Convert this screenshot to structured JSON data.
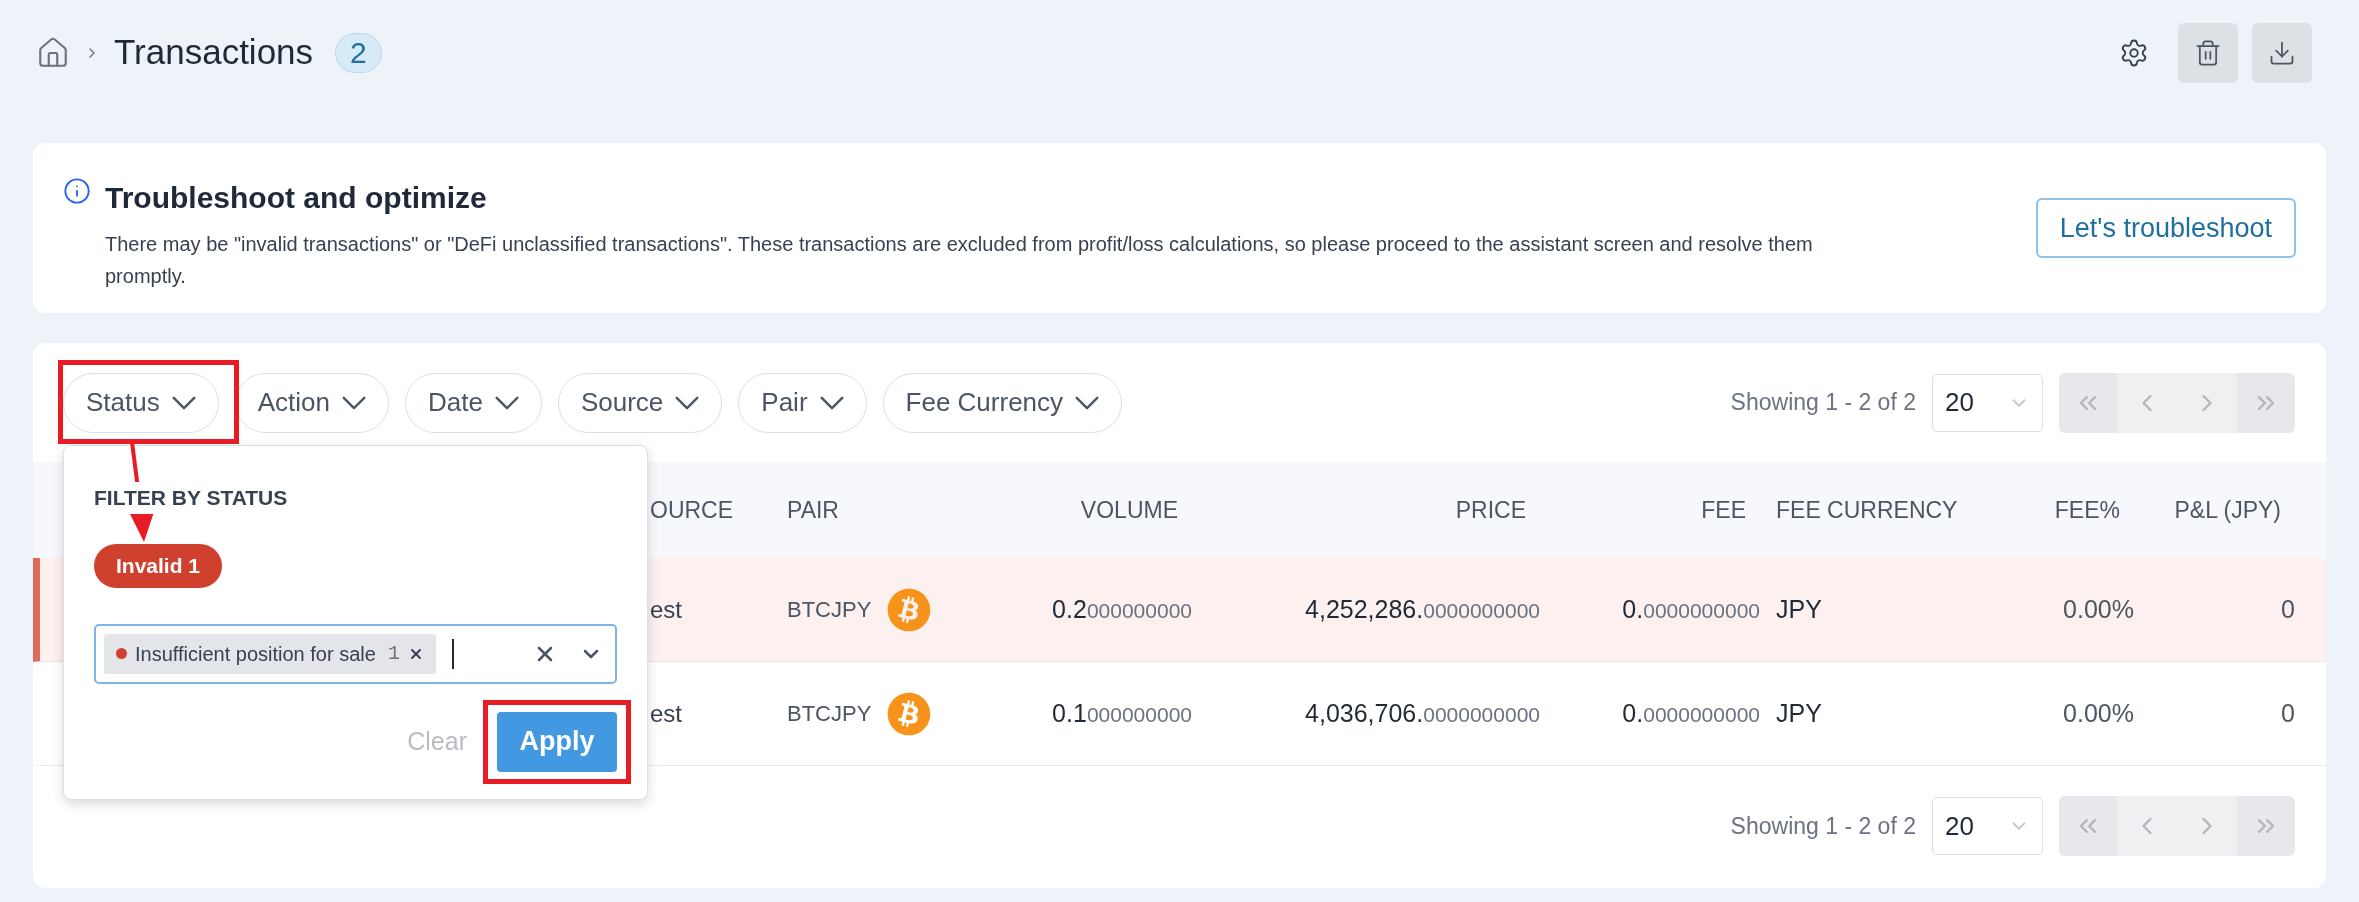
{
  "breadcrumb": {
    "title": "Transactions",
    "count": "2"
  },
  "banner": {
    "title": "Troubleshoot and optimize",
    "text": "There may be \"invalid transactions\" or \"DeFi unclassified transactions\". These transactions are excluded from profit/loss calculations, so please proceed to the assistant screen and resolve them promptly.",
    "button": "Let's troubleshoot"
  },
  "filters": [
    {
      "label": "Status"
    },
    {
      "label": "Action"
    },
    {
      "label": "Date"
    },
    {
      "label": "Source"
    },
    {
      "label": "Pair"
    },
    {
      "label": "Fee Currency"
    }
  ],
  "pagination_top": {
    "summary": "Showing 1 - 2 of 2",
    "page_size": "20"
  },
  "table": {
    "columns": [
      "OURCE",
      "PAIR",
      "VOLUME",
      "PRICE",
      "FEE",
      "FEE CURRENCY",
      "FEE%",
      "P&L (JPY)"
    ],
    "rows": [
      {
        "invalid": true,
        "source": "est",
        "pair": "BTCJPY",
        "volume": {
          "main": "0.2",
          "rest": "000000000"
        },
        "price": {
          "main": "4,252,286.",
          "rest": "0000000000"
        },
        "fee": {
          "main": "0.",
          "rest": "0000000000"
        },
        "fee_currency": "JPY",
        "fee_pct": "0.00%",
        "pnl": "0"
      },
      {
        "invalid": false,
        "source": "est",
        "pair": "BTCJPY",
        "volume": {
          "main": "0.1",
          "rest": "000000000"
        },
        "price": {
          "main": "4,036,706.",
          "rest": "0000000000"
        },
        "fee": {
          "main": "0.",
          "rest": "0000000000"
        },
        "fee_currency": "JPY",
        "fee_pct": "0.00%",
        "pnl": "0"
      }
    ]
  },
  "pagination_bottom": {
    "summary": "Showing 1 - 2 of 2",
    "page_size": "20"
  },
  "status_filter": {
    "heading": "FILTER BY STATUS",
    "tags": [
      {
        "label": "Invalid 1",
        "selected": true
      }
    ],
    "chips": [
      {
        "label": "Insufficient position for sale",
        "count": "1",
        "color": "#d0402f"
      }
    ],
    "clear": "Clear",
    "apply": "Apply"
  }
}
